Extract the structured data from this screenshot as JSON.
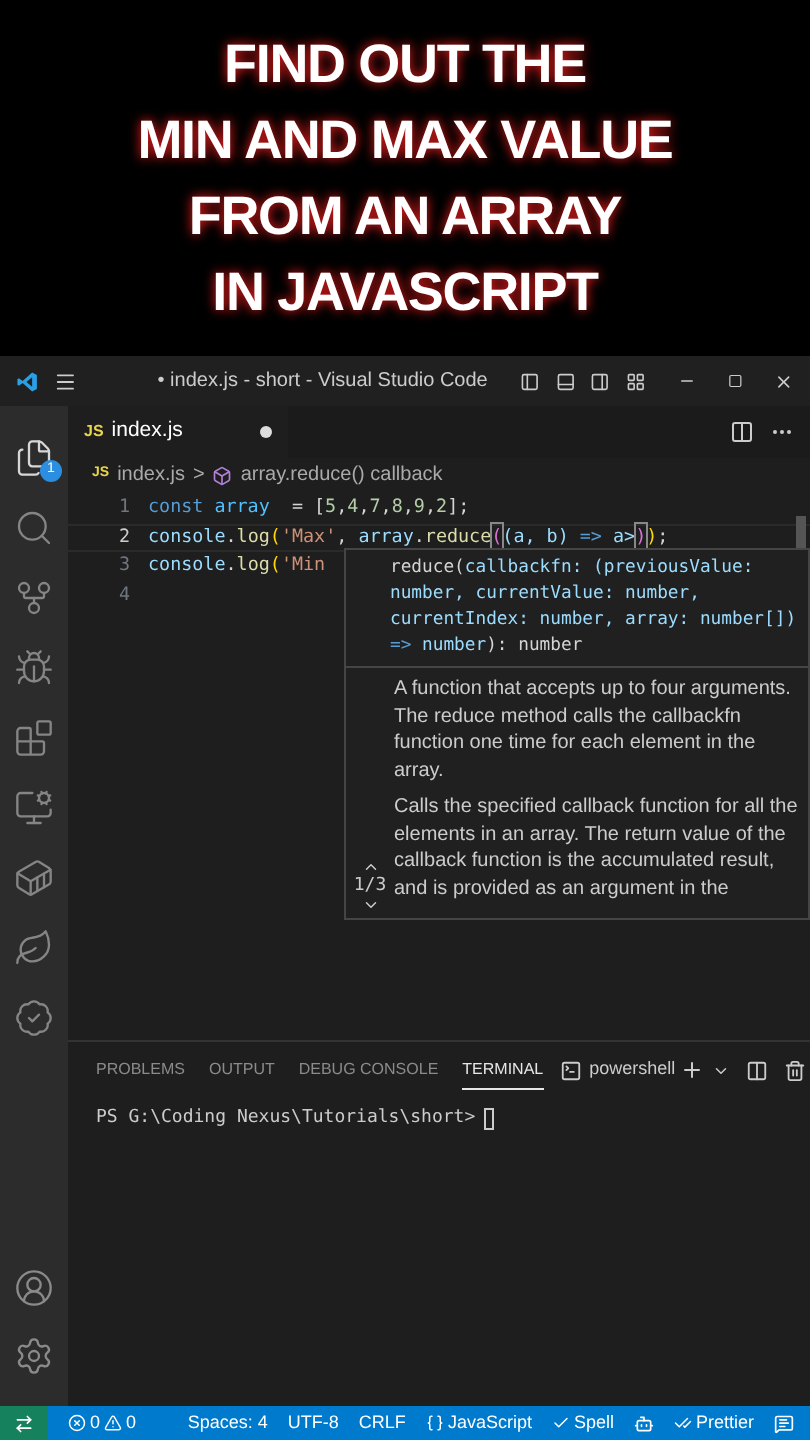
{
  "headline": {
    "lines": [
      "FIND OUT THE",
      "MIN AND MAX VALUE",
      "FROM AN ARRAY",
      "IN JAVASCRIPT"
    ]
  },
  "window": {
    "title": "• index.js - short - Visual Studio Code"
  },
  "activity_bar": {
    "items": [
      {
        "kind": "files",
        "selected": true,
        "badge": "1"
      },
      {
        "kind": "search",
        "selected": false
      },
      {
        "kind": "git",
        "selected": false
      },
      {
        "kind": "debug",
        "selected": false
      },
      {
        "kind": "extensions",
        "selected": false
      },
      {
        "kind": "remote",
        "selected": false
      },
      {
        "kind": "docker",
        "selected": false
      },
      {
        "kind": "leaf",
        "selected": false
      },
      {
        "kind": "badge",
        "selected": false
      }
    ],
    "bottom": [
      {
        "kind": "account"
      },
      {
        "kind": "settings"
      }
    ]
  },
  "tabs": [
    {
      "icon_text": "JS",
      "label": "index.js",
      "selected": true,
      "modified": true
    }
  ],
  "breadcrumb": {
    "icon_text": "JS",
    "file": "index.js",
    "separator": ">",
    "symbol": "array.reduce() callback"
  },
  "code": {
    "lines": [
      {
        "number": "1",
        "active": false,
        "tokens": [
          {
            "text": "const ",
            "kind": "keyword"
          },
          {
            "text": "array",
            "kind": "variable"
          },
          {
            "text": "  = [",
            "kind": "plain"
          },
          {
            "text": "5",
            "kind": "number"
          },
          {
            "text": ",",
            "kind": "plain"
          },
          {
            "text": "4",
            "kind": "number"
          },
          {
            "text": ",",
            "kind": "plain"
          },
          {
            "text": "7",
            "kind": "number"
          },
          {
            "text": ",",
            "kind": "plain"
          },
          {
            "text": "8",
            "kind": "number"
          },
          {
            "text": ",",
            "kind": "plain"
          },
          {
            "text": "9",
            "kind": "number"
          },
          {
            "text": ",",
            "kind": "plain"
          },
          {
            "text": "2",
            "kind": "number"
          },
          {
            "text": "];",
            "kind": "plain"
          }
        ]
      },
      {
        "number": "2",
        "active": true,
        "tokens": [
          {
            "text": "console",
            "kind": "param"
          },
          {
            "text": ".",
            "kind": "plain"
          },
          {
            "text": "log",
            "kind": "function"
          },
          {
            "text": "(",
            "kind": "bracket"
          },
          {
            "text": "'Max'",
            "kind": "string"
          },
          {
            "text": ", ",
            "kind": "plain"
          },
          {
            "text": "array",
            "kind": "param"
          },
          {
            "text": ".",
            "kind": "plain"
          },
          {
            "text": "reduce",
            "kind": "function"
          },
          {
            "text": "(",
            "kind": "match"
          },
          {
            "text": "(a, b) ",
            "kind": "param"
          },
          {
            "text": "=>",
            "kind": "keyword"
          },
          {
            "text": " a>",
            "kind": "param"
          },
          {
            "text": ")",
            "kind": "match"
          },
          {
            "text": ")",
            "kind": "bracket"
          },
          {
            "text": ";",
            "kind": "plain"
          }
        ]
      },
      {
        "number": "3",
        "active": false,
        "tokens": [
          {
            "text": "console",
            "kind": "param"
          },
          {
            "text": ".",
            "kind": "plain"
          },
          {
            "text": "log",
            "kind": "function"
          },
          {
            "text": "(",
            "kind": "bracket"
          },
          {
            "text": "'Min",
            "kind": "string"
          }
        ]
      },
      {
        "number": "4",
        "active": false
      }
    ]
  },
  "hover": {
    "signature": [
      {
        "text": "reduce(",
        "kind": "plain"
      },
      {
        "text": "callbackfn: (previousValue: number, currentValue: number, currentIndex: number, array: number[]) ",
        "kind": "param"
      },
      {
        "text": "=>",
        "kind": "keyword"
      },
      {
        "text": " number",
        "kind": "param"
      },
      {
        "text": "): number",
        "kind": "plain"
      }
    ],
    "paragraphs": [
      "A function that accepts up to four arguments. The reduce method calls the callbackfn function one time for each element in the array.",
      "Calls the specified callback function for all the elements in an array. The return value of the callback function is the accumulated result, and is provided as an argument in the"
    ],
    "counter": "1/3"
  },
  "panel": {
    "tabs": [
      {
        "label": "PROBLEMS",
        "selected": false
      },
      {
        "label": "OUTPUT",
        "selected": false
      },
      {
        "label": "DEBUG CONSOLE",
        "selected": false
      },
      {
        "label": "TERMINAL",
        "selected": true
      }
    ],
    "shell": "powershell",
    "prompt": "PS G:\\Coding Nexus\\Tutorials\\short>"
  },
  "status_bar": {
    "errors": "0",
    "warnings": "0",
    "items": [
      {
        "kind": "text",
        "label": "Spaces: 4"
      },
      {
        "kind": "text",
        "label": "UTF-8"
      },
      {
        "kind": "text",
        "label": "CRLF"
      },
      {
        "kind": "language",
        "label": "JavaScript"
      },
      {
        "kind": "check",
        "label": "Spell"
      },
      {
        "kind": "copilot"
      },
      {
        "kind": "double-check",
        "label": "Prettier"
      },
      {
        "kind": "feedback"
      }
    ]
  }
}
